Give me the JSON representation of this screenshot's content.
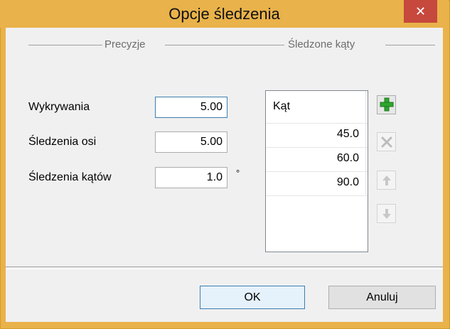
{
  "dialog": {
    "title": "Opcje śledzenia",
    "close_glyph": "✕"
  },
  "precision_group": {
    "title": "Precyzje",
    "fields": [
      {
        "label": "Wykrywania",
        "value": "5.00"
      },
      {
        "label": "Śledzenia osi",
        "value": "5.00"
      },
      {
        "label": "Śledzenia kątów",
        "value": "1.0"
      }
    ],
    "angle_unit": "°"
  },
  "tracked_angles_group": {
    "title": "Śledzone kąty",
    "column_header": "Kąt",
    "angles": [
      "45.0",
      "60.0",
      "90.0"
    ],
    "buttons": {
      "add_icon": "plus-icon",
      "delete_icon": "delete-icon",
      "up_icon": "arrow-up-icon",
      "down_icon": "arrow-down-icon"
    }
  },
  "footer": {
    "ok_label": "OK",
    "cancel_label": "Anuluj"
  }
}
